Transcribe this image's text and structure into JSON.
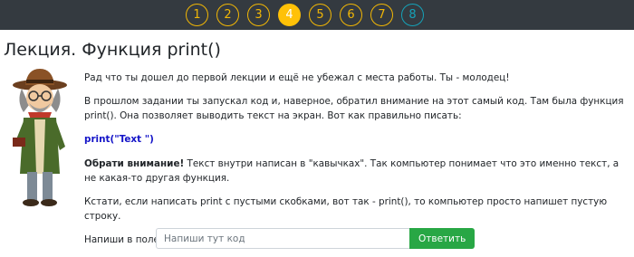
{
  "pager": {
    "pages": [
      {
        "label": "1",
        "state": "done"
      },
      {
        "label": "2",
        "state": "done"
      },
      {
        "label": "3",
        "state": "done"
      },
      {
        "label": "4",
        "state": "active"
      },
      {
        "label": "5",
        "state": "done"
      },
      {
        "label": "6",
        "state": "done"
      },
      {
        "label": "7",
        "state": "done"
      },
      {
        "label": "8",
        "state": "locked"
      }
    ]
  },
  "lesson": {
    "title": "Лекция. Функция print()",
    "p1": "Рад что ты дошел до первой лекции и ещё не убежал с места работы. Ты - молодец!",
    "p2": "В прошлом задании ты запускал код и, наверное, обратил внимание на этот самый код. Там была функция print(). Она позволяет выводить текст на экран. Вот как правильно писать:",
    "code": "print(\"Text \")",
    "note_bold": "Обрати внимание!",
    "note_text": " Текст внутри написан в \"кавычках\". Так компьютер понимает что это именно текст, а не какая-то другая функция.",
    "p4": "Кстати, если написать print с пустыми скобками, вот так - print(), то компьютер просто напишет пустую строку.",
    "p5": "Напиши в поле для ответа код, который напечатает строку Python is cool."
  },
  "answer": {
    "placeholder": "Напиши тут код",
    "value": "",
    "submit_label": "Ответить"
  },
  "colors": {
    "topbar": "#343a40",
    "page_outline": "#f2b705",
    "page_active": "#ffc107",
    "page_locked": "#15a2b8",
    "code": "#1414c8",
    "submit": "#28a745"
  }
}
